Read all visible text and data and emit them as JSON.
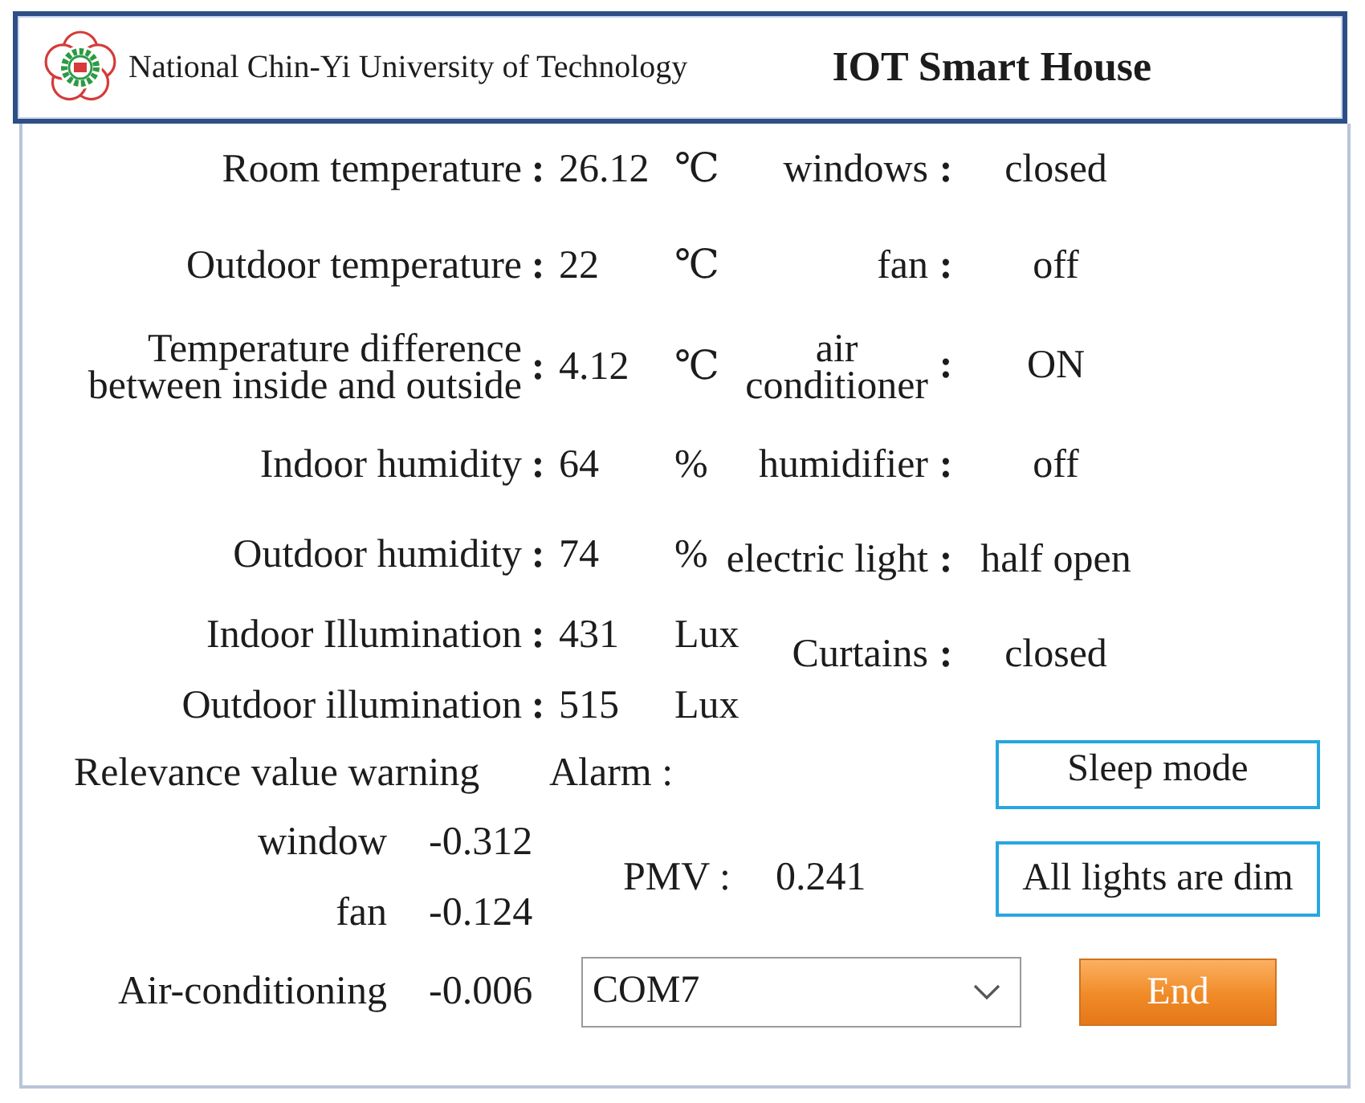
{
  "header": {
    "university": "National Chin-Yi University of Technology",
    "title": "IOT Smart House"
  },
  "readings": [
    {
      "label": "Room temperature",
      "colon": ":",
      "value": "26.12",
      "unit": "℃"
    },
    {
      "label": "Outdoor temperature",
      "colon": ":",
      "value": "22",
      "unit": "℃"
    },
    {
      "label": "Temperature difference\nbetween inside and outside",
      "colon": ":",
      "value": "4.12",
      "unit": "℃"
    },
    {
      "label": "Indoor humidity",
      "colon": ":",
      "value": "64",
      "unit": "%"
    },
    {
      "label": "Outdoor humidity",
      "colon": ":",
      "value": "74",
      "unit": "%"
    },
    {
      "label": "Indoor Illumination",
      "colon": ":",
      "value": "431",
      "unit": "Lux"
    },
    {
      "label": "Outdoor illumination",
      "colon": ":",
      "value": "515",
      "unit": "Lux"
    }
  ],
  "devices": [
    {
      "label": "windows",
      "colon": ":",
      "state": "closed"
    },
    {
      "label": "fan",
      "colon": ":",
      "state": "off"
    },
    {
      "label": "air\nconditioner",
      "colon": ":",
      "state": "ON"
    },
    {
      "label": "humidifier",
      "colon": ":",
      "state": "off"
    },
    {
      "label": "electric light",
      "colon": ":",
      "state": "half open"
    },
    {
      "label": "Curtains",
      "colon": ":",
      "state": "closed"
    }
  ],
  "relevance": {
    "title": "Relevance value warning",
    "items": [
      {
        "label": "window",
        "value": "-0.312"
      },
      {
        "label": "fan",
        "value": "-0.124"
      },
      {
        "label": "Air-conditioning",
        "value": "-0.006"
      }
    ]
  },
  "alarm": {
    "label": "Alarm :"
  },
  "pmv": {
    "label": "PMV :",
    "value": "0.241"
  },
  "mode_buttons": [
    {
      "label": "Sleep mode"
    },
    {
      "label": "All lights are dim"
    }
  ],
  "port_select": {
    "value": "COM7"
  },
  "end_button": {
    "label": "End"
  }
}
